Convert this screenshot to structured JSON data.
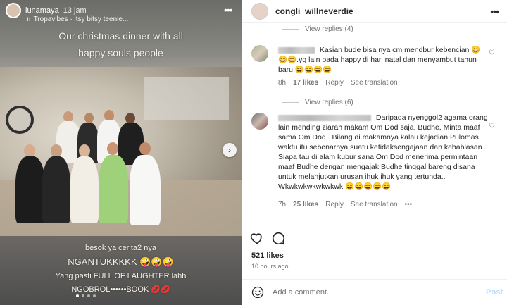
{
  "story": {
    "username": "lunamaya",
    "time": "13 jam",
    "music": "Tropavibes · itsy bitsy teenie...",
    "caption_top_1": "Our christmas dinner with all",
    "caption_top_2": "happy souls people",
    "caption_b1": "besok ya cerita2 nya",
    "caption_b2": "NGANTUKKKKK 🤪🤪🤪",
    "caption_b3": "Yang pasti FULL OF LAUGHTER lahh",
    "caption_b4": "NGOBROL••••••BOOK 💋💋"
  },
  "post": {
    "username": "congli_willneverdie",
    "view_replies_1": "View replies (4)",
    "view_replies_2": "View replies (6)",
    "comments": [
      {
        "text": "Kasian bude bisa nya cm mendbur kebencian 😄😄😄.yg lain pada happy di hari natal dan menyambut tahun baru 😄😄😄😄",
        "time": "8h",
        "likes": "17 likes",
        "reply": "Reply",
        "translation": "See translation"
      },
      {
        "text": "Daripada nyenggol2 agama orang lain mending ziarah makam Om Dod saja. Budhe, Minta maaf sama Om Dod.. Bilang di makamnya kalau kejadian Pulomas waktu itu sebenarnya suatu ketidaksengajaan dan kebablasan.. Siapa tau di alam kubur sana Om Dod menerima permintaan maaf Budhe dengan mengajak Budhe tinggal bareng disana untuk melanjutkan urusan ihuk ihuk yang tertunda.. Wkwkwkwkwkwkwk 😄😄😄😄😄",
        "time": "7h",
        "likes": "25 likes",
        "reply": "Reply",
        "translation": "See translation"
      }
    ],
    "likes_total": "521 likes",
    "time_ago": "10 hours ago",
    "add_comment_placeholder": "Add a comment...",
    "post_label": "Post"
  },
  "colors": {
    "accent_post": "#b3dbff",
    "text_primary": "#262626",
    "text_secondary": "#737373"
  },
  "icons": [
    "heart-icon",
    "comment-icon",
    "share-icon",
    "bookmark-icon",
    "emoji-icon",
    "more-icon",
    "chevron-right-icon"
  ]
}
